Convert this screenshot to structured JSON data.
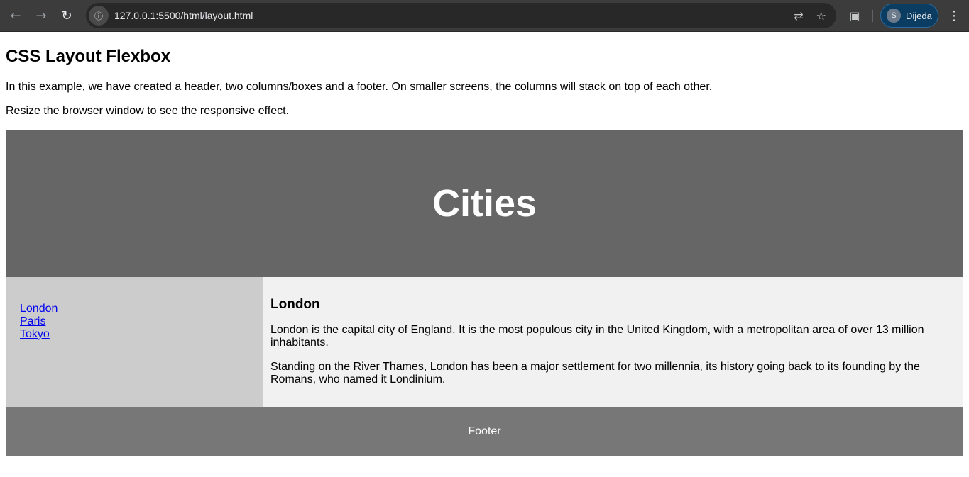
{
  "browser": {
    "back_icon": "arrow-left-icon",
    "forward_icon": "arrow-right-icon",
    "reload_icon": "reload-icon",
    "site_info_icon": "info-icon",
    "url": "127.0.0.1:5500/html/layout.html",
    "translate_icon": "translate-icon",
    "bookmark_icon": "star-icon",
    "extensions_icon": "puzzle-icon",
    "profile": {
      "initial": "S",
      "name": "Dijeda"
    },
    "menu_icon": "kebab-menu-icon"
  },
  "page": {
    "title": "CSS Layout Flexbox",
    "intro": "In this example, we have created a header, two columns/boxes and a footer. On smaller screens, the columns will stack on top of each other.",
    "resize_note": "Resize the browser window to see the responsive effect.",
    "header_title": "Cities",
    "menu": [
      {
        "label": "London"
      },
      {
        "label": "Paris"
      },
      {
        "label": "Tokyo"
      }
    ],
    "content": {
      "heading": "London",
      "paragraph1": "London is the capital city of England. It is the most populous city in the United Kingdom, with a metropolitan area of over 13 million inhabitants.",
      "paragraph2": "Standing on the River Thames, London has been a major settlement for two millennia, its history going back to its founding by the Romans, who named it Londinium."
    },
    "footer": "Footer"
  },
  "colors": {
    "header_bg": "#666666",
    "menu_bg": "#cccccc",
    "content_bg": "#f1f1f1",
    "footer_bg": "#777777",
    "link": "#0000ee"
  }
}
